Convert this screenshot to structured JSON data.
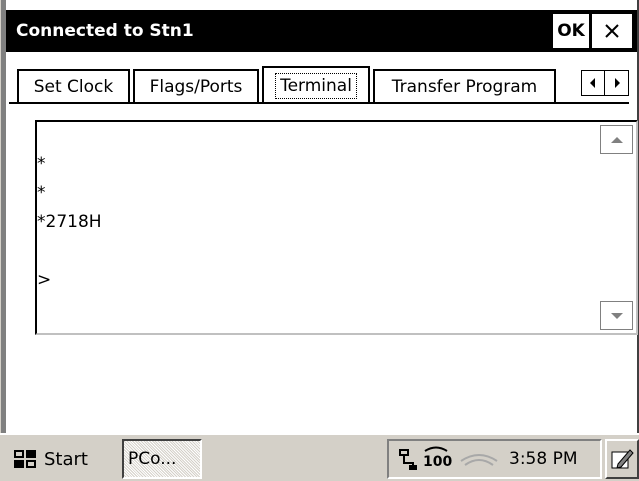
{
  "window": {
    "title": "Connected to Stn1",
    "ok_label": "OK",
    "close_icon": "close-icon"
  },
  "tabs": [
    {
      "label": "Set Clock",
      "active": false
    },
    {
      "label": "Flags/Ports",
      "active": false
    },
    {
      "label": "Terminal",
      "active": true
    },
    {
      "label": "Transfer Program",
      "active": false
    }
  ],
  "terminal": {
    "text": "*\n*\n*2718H\n\n>"
  },
  "taskbar": {
    "start_label": "Start",
    "task_label": "PCo...",
    "clock": "3:58 PM",
    "tray_icons": [
      "network-icon",
      "battery-icon",
      "volume-icon"
    ]
  }
}
